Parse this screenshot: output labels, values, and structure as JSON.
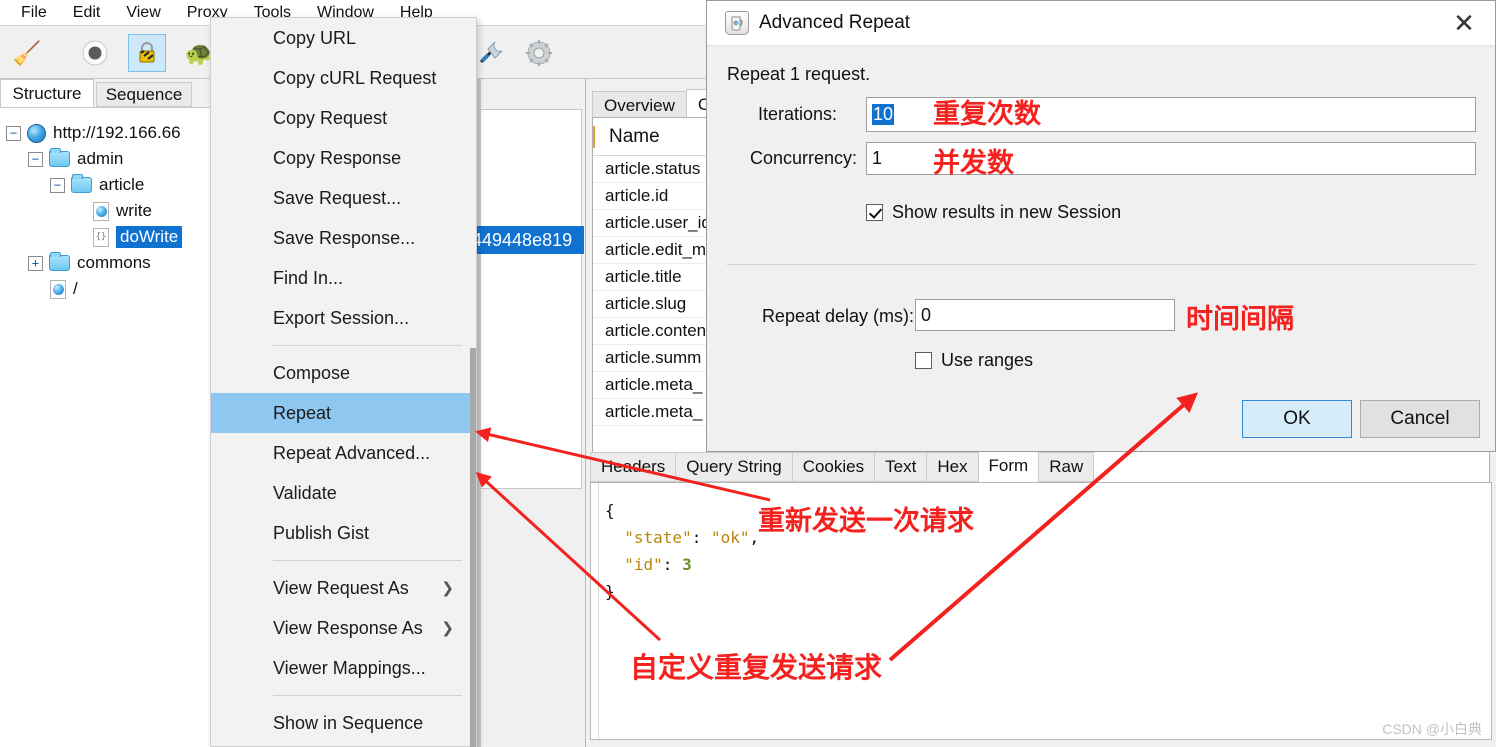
{
  "app": {
    "menubar": [
      "File",
      "Edit",
      "View",
      "Proxy",
      "Tools",
      "Window",
      "Help"
    ],
    "toolbar_icons": [
      "broom-icon",
      "record-icon",
      "lock-icon",
      "turtle-icon",
      "wrench-icon",
      "gear-icon"
    ]
  },
  "left": {
    "tabs": [
      {
        "label": "Structure",
        "active": true
      },
      {
        "label": "Sequence",
        "active": false
      }
    ],
    "tree": [
      {
        "label": "http://192.166.66",
        "indent": 0,
        "expander": "minus",
        "icon": "globe-icon",
        "selected": false
      },
      {
        "label": "admin",
        "indent": 1,
        "expander": "minus",
        "icon": "folder-icon",
        "selected": false
      },
      {
        "label": "article",
        "indent": 2,
        "expander": "minus",
        "icon": "folder-icon",
        "selected": false
      },
      {
        "label": "write",
        "indent": 3,
        "expander": "none",
        "icon": "page-blue-icon",
        "selected": false
      },
      {
        "label": "doWrite",
        "indent": 3,
        "expander": "none",
        "icon": "page-code-icon",
        "selected": true
      },
      {
        "label": "commons",
        "indent": 1,
        "expander": "plus",
        "icon": "folder-icon",
        "selected": false
      },
      {
        "label": "/",
        "indent": 2,
        "expander": "none",
        "icon": "page-blue-icon",
        "selected": false
      }
    ]
  },
  "session": {
    "selected_cell": "449448e819"
  },
  "context_menu": {
    "items": [
      {
        "label": "Copy URL",
        "type": "item"
      },
      {
        "label": "Copy cURL Request",
        "type": "item"
      },
      {
        "label": "Copy Request",
        "type": "item"
      },
      {
        "label": "Copy Response",
        "type": "item"
      },
      {
        "label": "Save Request...",
        "type": "item"
      },
      {
        "label": "Save Response...",
        "type": "item"
      },
      {
        "label": "Find In...",
        "type": "item"
      },
      {
        "label": "Export Session...",
        "type": "item"
      },
      {
        "type": "separator"
      },
      {
        "label": "Compose",
        "type": "item"
      },
      {
        "label": "Repeat",
        "type": "item",
        "highlight": true
      },
      {
        "label": "Repeat Advanced...",
        "type": "item"
      },
      {
        "label": "Validate",
        "type": "item"
      },
      {
        "label": "Publish Gist",
        "type": "item"
      },
      {
        "type": "separator"
      },
      {
        "label": "View Request As",
        "type": "item",
        "submenu": true
      },
      {
        "label": "View Response As",
        "type": "item",
        "submenu": true
      },
      {
        "label": "Viewer Mappings...",
        "type": "item"
      },
      {
        "type": "separator"
      },
      {
        "label": "Show in Sequence",
        "type": "item"
      }
    ]
  },
  "inspector": {
    "top_tabs": [
      {
        "label": "Overview",
        "active": false
      },
      {
        "label": "Co",
        "active": true
      }
    ],
    "params_header": "Name",
    "params": [
      "article.status",
      "article.id",
      "article.user_id",
      "article.edit_m",
      "article.title",
      "article.slug",
      "article.conten",
      "article.summ",
      "article.meta_",
      "article.meta_"
    ],
    "bottom_tabs": [
      {
        "label": "Headers",
        "active": false
      },
      {
        "label": "Query String",
        "active": false
      },
      {
        "label": "Cookies",
        "active": false
      },
      {
        "label": "Text",
        "active": false
      },
      {
        "label": "Hex",
        "active": false
      },
      {
        "label": "Form",
        "active": true
      },
      {
        "label": "Raw",
        "active": false
      }
    ],
    "body_json": {
      "line1": "{",
      "line2_key": "\"state\"",
      "line2_val": "\"ok\"",
      "line3_key": "\"id\"",
      "line3_val": "3",
      "line4": "}"
    }
  },
  "dialog": {
    "title": "Advanced Repeat",
    "close_label": "✕",
    "subtitle": "Repeat 1 request.",
    "iterations_label": "Iterations:",
    "iterations_value": "10",
    "concurrency_label": "Concurrency:",
    "concurrency_value": "1",
    "show_results_label": "Show results in new Session",
    "show_results_checked": true,
    "repeat_delay_label": "Repeat delay (ms):",
    "repeat_delay_value": "0",
    "use_ranges_label": "Use ranges",
    "use_ranges_checked": false,
    "ok_label": "OK",
    "cancel_label": "Cancel"
  },
  "annotations": {
    "iterations": "重复次数",
    "concurrency": "并发数",
    "delay": "时间间隔",
    "repeat_once": "重新发送一次请求",
    "repeat_custom": "自定义重复发送请求",
    "color": "#f3221e"
  },
  "watermark": "CSDN @小白典"
}
